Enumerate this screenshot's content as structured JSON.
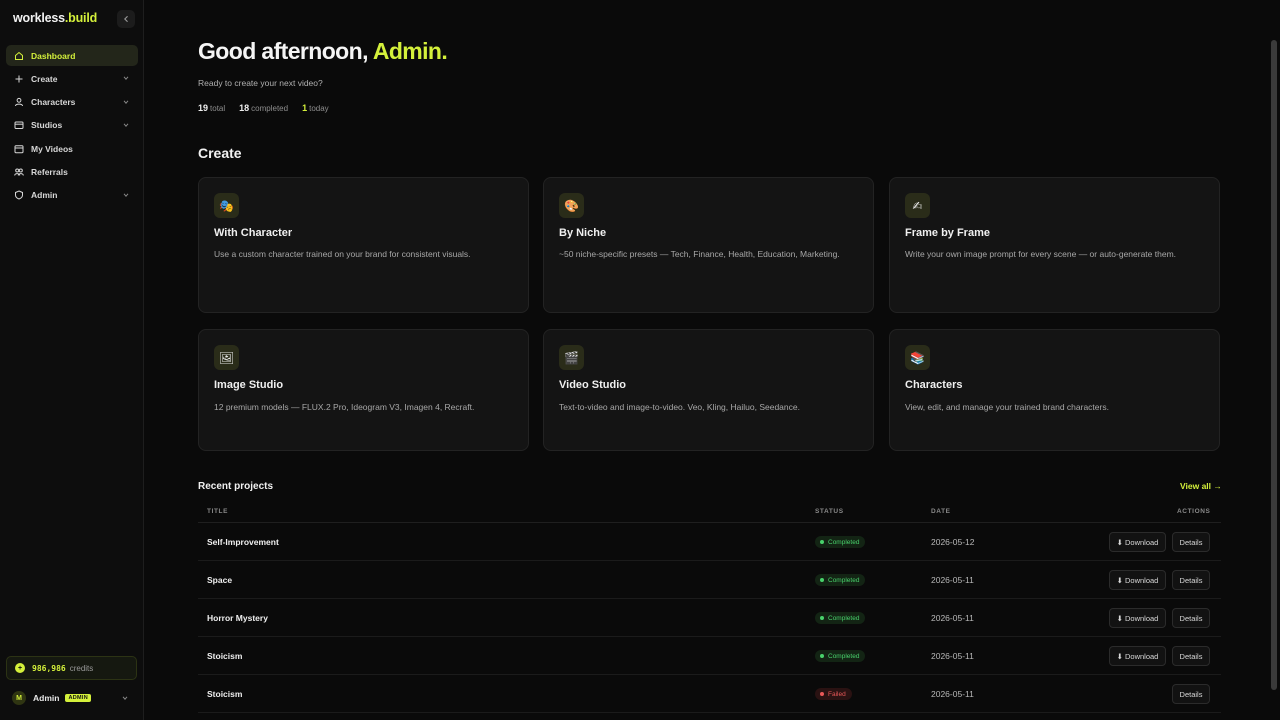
{
  "brand": {
    "name": "workless",
    "suffix": ".build"
  },
  "sidebar": {
    "collapse_icon": "chevron-left-icon",
    "items": [
      {
        "label": "Dashboard",
        "icon": "home-icon",
        "active": true,
        "has_chevron": false
      },
      {
        "label": "Create",
        "icon": "plus-icon",
        "active": false,
        "has_chevron": true
      },
      {
        "label": "Characters",
        "icon": "user-icon",
        "active": false,
        "has_chevron": true
      },
      {
        "label": "Studios",
        "icon": "studio-icon",
        "active": false,
        "has_chevron": true
      },
      {
        "label": "My Videos",
        "icon": "calendar-icon",
        "active": false,
        "has_chevron": false
      },
      {
        "label": "Referrals",
        "icon": "users-icon",
        "active": false,
        "has_chevron": false
      },
      {
        "label": "Admin",
        "icon": "shield-icon",
        "active": false,
        "has_chevron": true
      }
    ],
    "credits": {
      "amount": "986,986",
      "label": "credits"
    },
    "user": {
      "initial": "M",
      "name": "Admin",
      "role": "ADMIN"
    }
  },
  "header": {
    "greeting_prefix": "Good afternoon, ",
    "greeting_name": "Admin.",
    "subtitle": "Ready to create your next video?",
    "stats": [
      {
        "value": "19",
        "label": "total"
      },
      {
        "value": "18",
        "label": "completed"
      },
      {
        "value": "1",
        "label": "today"
      }
    ]
  },
  "create": {
    "title": "Create",
    "cards": [
      {
        "title": "With Character",
        "icon": "🎭",
        "icon_name": "theater-masks-icon",
        "desc": "Use a custom character trained on your brand for consistent visuals."
      },
      {
        "title": "By Niche",
        "icon": "🎨",
        "icon_name": "palette-icon",
        "desc": "~50 niche-specific presets — Tech, Finance, Health, Education, Marketing."
      },
      {
        "title": "Frame by Frame",
        "icon": "✍",
        "icon_name": "writing-hand-icon",
        "desc": "Write your own image prompt for every scene — or auto-generate them."
      },
      {
        "title": "Image Studio",
        "icon": "🖼",
        "icon_name": "framed-picture-icon",
        "desc": "12 premium models — FLUX.2 Pro, Ideogram V3, Imagen 4, Recraft."
      },
      {
        "title": "Video Studio",
        "icon": "🎬",
        "icon_name": "clapper-board-icon",
        "desc": "Text-to-video and image-to-video. Veo, Kling, Hailuo, Seedance."
      },
      {
        "title": "Characters",
        "icon": "📚",
        "icon_name": "books-icon",
        "desc": "View, edit, and manage your trained brand characters."
      }
    ]
  },
  "recent": {
    "title": "Recent projects",
    "view_all": "View all →",
    "columns": {
      "title": "TITLE",
      "status": "STATUS",
      "date": "DATE",
      "actions": "ACTIONS"
    },
    "download_label": "⬇ Download",
    "details_label": "Details",
    "rows": [
      {
        "title": "Self-Improvement",
        "status": "Completed",
        "date": "2026-05-12",
        "downloadable": true
      },
      {
        "title": "Space",
        "status": "Completed",
        "date": "2026-05-11",
        "downloadable": true
      },
      {
        "title": "Horror Mystery",
        "status": "Completed",
        "date": "2026-05-11",
        "downloadable": true
      },
      {
        "title": "Stoicism",
        "status": "Completed",
        "date": "2026-05-11",
        "downloadable": true
      },
      {
        "title": "Stoicism",
        "status": "Failed",
        "date": "2026-05-11",
        "downloadable": false
      }
    ]
  },
  "colors": {
    "accent": "#d4f03b",
    "success": "#48d16b",
    "danger": "#e85858",
    "background": "#0a0a0a",
    "card": "#141414"
  }
}
